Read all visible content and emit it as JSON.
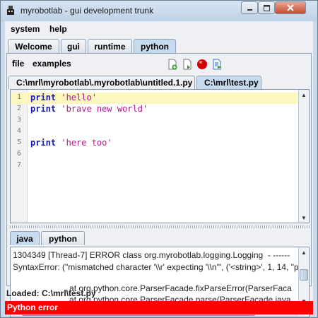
{
  "window": {
    "title": "myrobotlab - gui development trunk"
  },
  "menubar": {
    "items": [
      "system",
      "help"
    ]
  },
  "tabs": [
    {
      "label": "Welcome",
      "active": false
    },
    {
      "label": "gui",
      "active": false
    },
    {
      "label": "runtime",
      "active": false
    },
    {
      "label": "python",
      "active": true
    }
  ],
  "python_toolbar": {
    "menu": [
      "file",
      "examples"
    ],
    "icons": [
      "new-file-icon",
      "open-file-icon",
      "stop-icon",
      "run-icon"
    ]
  },
  "file_tabs": [
    {
      "label": "C:\\mrl\\myrobotlab\\.myrobotlab\\untitled.1.py",
      "active": false
    },
    {
      "label": "C:\\mrl\\test.py",
      "active": true
    }
  ],
  "editor": {
    "lines": [
      {
        "n": "1",
        "kw": "print",
        "str": "'hello'"
      },
      {
        "n": "2",
        "kw": "print",
        "str": "'brave new world'"
      },
      {
        "n": "3",
        "kw": "",
        "str": ""
      },
      {
        "n": "4",
        "kw": "",
        "str": ""
      },
      {
        "n": "5",
        "kw": "print",
        "str": "'here too'"
      },
      {
        "n": "6",
        "kw": "",
        "str": ""
      },
      {
        "n": "7",
        "kw": "",
        "str": ""
      }
    ]
  },
  "lower_tabs": [
    {
      "label": "java",
      "active": true
    },
    {
      "label": "python",
      "active": false
    }
  ],
  "console": {
    "lines": [
      "1304349 [Thread-7] ERROR class org.myrobotlab.logging.Logging  - ------",
      "SyntaxError: (\"mismatched character '\\\\r' expecting '\\\\n'\", ('<string>', 1, 14, \"p",
      "",
      "                        at org.python.core.ParserFacade.fixParseError(ParserFaca",
      "                        at org.python.core.ParserFacade.parse(ParserFacade.java"
    ]
  },
  "loaded_label": "Loaded: C:\\mrl\\test.py",
  "status": {
    "text": "Python error",
    "color": "#ff0000"
  }
}
